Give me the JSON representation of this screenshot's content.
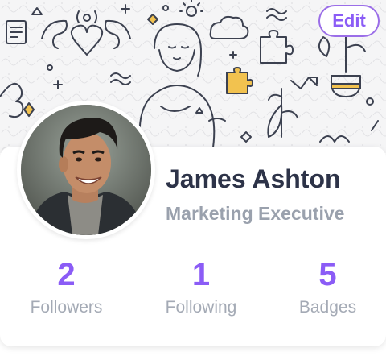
{
  "header": {
    "edit_label": "Edit"
  },
  "profile": {
    "name": "James Ashton",
    "title": "Marketing Executive",
    "avatar_icon": "avatar-photo"
  },
  "stats": [
    {
      "value": "2",
      "label": "Followers"
    },
    {
      "value": "1",
      "label": "Following"
    },
    {
      "value": "5",
      "label": "Badges"
    }
  ],
  "colors": {
    "accent": "#8b5cf6",
    "name_text": "#2d3348",
    "muted_text": "#9aa1ad",
    "doodle_stroke": "#3c4150",
    "doodle_fill": "#f2c24f"
  }
}
